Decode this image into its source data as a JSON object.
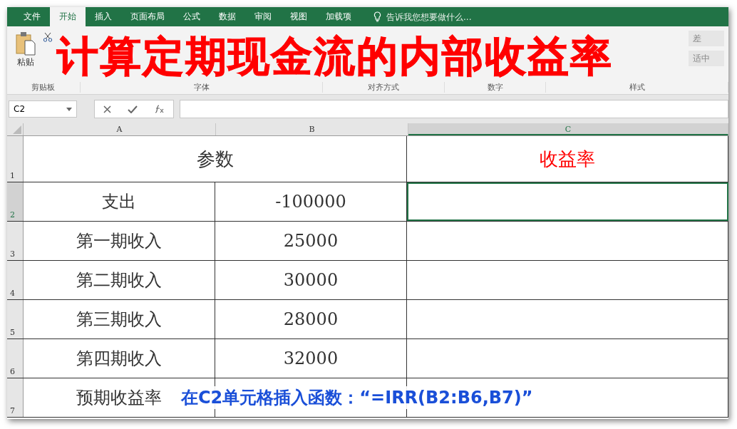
{
  "tabs": [
    {
      "label": "文件",
      "selected": false
    },
    {
      "label": "开始",
      "selected": true
    },
    {
      "label": "插入",
      "selected": false
    },
    {
      "label": "页面布局",
      "selected": false
    },
    {
      "label": "公式",
      "selected": false
    },
    {
      "label": "数据",
      "selected": false
    },
    {
      "label": "审阅",
      "selected": false
    },
    {
      "label": "视图",
      "selected": false
    },
    {
      "label": "加载项",
      "selected": false
    }
  ],
  "tell_me": {
    "placeholder": "告诉我您想要做什么..."
  },
  "ribbon": {
    "paste": "粘贴",
    "groups": [
      "剪贴板",
      "字体",
      "对齐方式",
      "数字",
      "样式"
    ],
    "styles": [
      "差",
      "适中"
    ]
  },
  "overlay_title": "计算定期现金流的内部收益率",
  "formula_bar": {
    "name_box": "C2"
  },
  "columns": [
    {
      "label": "A",
      "selected": false
    },
    {
      "label": "B",
      "selected": false
    },
    {
      "label": "C",
      "selected": true
    }
  ],
  "header_row": {
    "number": "1",
    "cells": [
      {
        "text": "参数",
        "color": "#333333"
      },
      {
        "text": "收益率",
        "color": "#ff0000"
      }
    ]
  },
  "rows": [
    {
      "number": "2",
      "selected": true,
      "cells": [
        "支出",
        "-100000",
        ""
      ]
    },
    {
      "number": "3",
      "selected": false,
      "cells": [
        "第一期收入",
        "25000",
        ""
      ]
    },
    {
      "number": "4",
      "selected": false,
      "cells": [
        "第二期收入",
        "30000",
        ""
      ]
    },
    {
      "number": "5",
      "selected": false,
      "cells": [
        "第三期收入",
        "28000",
        ""
      ]
    },
    {
      "number": "6",
      "selected": false,
      "cells": [
        "第四期收入",
        "32000",
        ""
      ]
    },
    {
      "number": "7",
      "selected": false,
      "cells": [
        "预期收益率",
        "",
        ""
      ]
    }
  ],
  "caption": "在C2单元格插入函数：“=IRR(B2:B6,B7)”"
}
